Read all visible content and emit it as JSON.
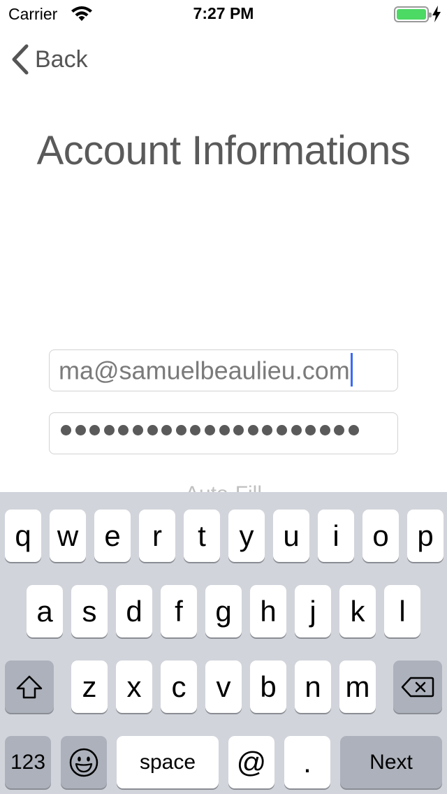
{
  "status_bar": {
    "carrier": "Carrier",
    "time": "7:27 PM",
    "battery_level": 1.0,
    "battery_color": "#4cd964",
    "wifi_icon": "wifi-icon",
    "charging_icon": "bolt-icon"
  },
  "nav": {
    "back_label": "Back",
    "back_icon": "chevron-left-icon"
  },
  "title": "Account Informations",
  "form": {
    "email_value": "ma@samuelbeaulieu.com",
    "password_mask_count": 21,
    "autofill_label": "Auto-Fill",
    "cursor_color": "#3a6af7"
  },
  "keyboard": {
    "row1": [
      "q",
      "w",
      "e",
      "r",
      "t",
      "y",
      "u",
      "i",
      "o",
      "p"
    ],
    "row2": [
      "a",
      "s",
      "d",
      "f",
      "g",
      "h",
      "j",
      "k",
      "l"
    ],
    "row3": [
      "z",
      "x",
      "c",
      "v",
      "b",
      "n",
      "m"
    ],
    "shift_icon": "shift-icon",
    "delete_icon": "delete-backspace-icon",
    "numbers_label": "123",
    "emoji_icon": "emoji-icon",
    "space_label": "space",
    "at_label": "@",
    "period_label": ".",
    "next_label": "Next"
  }
}
